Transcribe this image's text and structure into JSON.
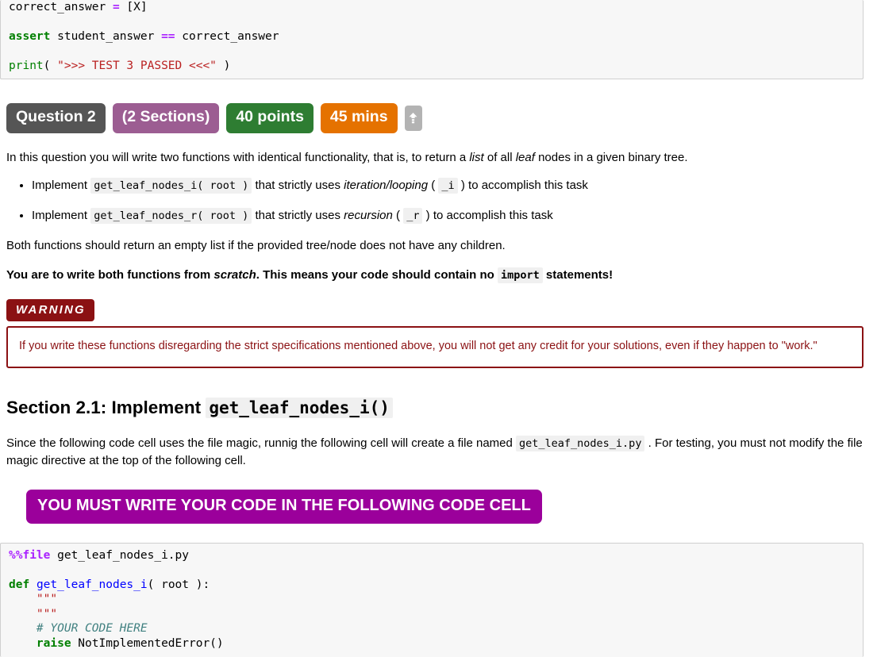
{
  "top_code_cell": {
    "name": "test-3-code-cell",
    "lines": [
      [
        {
          "t": "correct_answer ",
          "c": "plain"
        },
        {
          "t": "=",
          "c": "op"
        },
        {
          "t": " [X]",
          "c": "plain"
        }
      ],
      [],
      [
        {
          "t": "assert",
          "c": "kw"
        },
        {
          "t": " student_answer ",
          "c": "plain"
        },
        {
          "t": "==",
          "c": "op"
        },
        {
          "t": " correct_answer",
          "c": "plain"
        }
      ],
      [],
      [
        {
          "t": "print",
          "c": "bi"
        },
        {
          "t": "( ",
          "c": "plain"
        },
        {
          "t": "\">>> TEST 3 PASSED <<<\"",
          "c": "str"
        },
        {
          "t": " )",
          "c": "plain"
        }
      ]
    ]
  },
  "badges": {
    "question": "Question 2",
    "sections": "(2 Sections)",
    "points": "40 points",
    "time": "45 mins",
    "toggle_icon": "arrow-up-icon",
    "colors": {
      "question": "#555555",
      "sections": "#9c5d92",
      "points": "#2e7d32",
      "time": "#e57200",
      "toggle": "#b3b3b3"
    }
  },
  "intro": {
    "p1_a": "In this question you will write two functions with identical functionality, that is, to return a ",
    "p1_list": "list",
    "p1_b": " of all ",
    "p1_leaf": "leaf",
    "p1_c": " nodes in a given binary tree."
  },
  "bullets": [
    {
      "lead": "Implement ",
      "code": "get_leaf_nodes_i( root )",
      "mid": " that strictly uses ",
      "em": "iteration/looping",
      "paren_open": " ( ",
      "code2": "_i",
      "paren_close": " ) ",
      "tail": "to accomplish this task"
    },
    {
      "lead": "Implement ",
      "code": "get_leaf_nodes_r( root )",
      "mid": " that strictly uses ",
      "em": "recursion",
      "paren_open": " ( ",
      "code2": "_r",
      "paren_close": " ) ",
      "tail": "to accomplish this task"
    }
  ],
  "notes": {
    "empty_list": "Both functions should return an empty list if the provided tree/node does not have any children.",
    "scratch_a": "You are to write both functions from ",
    "scratch_em": "scratch",
    "scratch_b": ". This means your code should contain no ",
    "scratch_code": "import",
    "scratch_c": " statements!"
  },
  "warning": {
    "label": "WARNING",
    "text": "If you write these functions disregarding the strict specifications mentioned above, you will not get any credit for your solutions, even if they happen to \"work.\"",
    "color": "#8b1113"
  },
  "section": {
    "heading_text": "Section 2.1: Implement ",
    "heading_code": "get_leaf_nodes_i()",
    "para_a": "Since the following code cell uses the file magic, runnig the following cell will create a file named ",
    "para_code": "get_leaf_nodes_i.py",
    "para_b": " . For testing, you must not modify the file magic directive at the top of the following cell."
  },
  "must_banner": {
    "text": "YOU MUST WRITE YOUR CODE IN THE FOLLOWING CODE CELL",
    "color": "#9b009b"
  },
  "bottom_code_cell": {
    "name": "get-leaf-nodes-i-code-cell",
    "lines": [
      [
        {
          "t": "%%file",
          "c": "magic"
        },
        {
          "t": " get_leaf_nodes_i.py",
          "c": "plain"
        }
      ],
      [],
      [
        {
          "t": "def",
          "c": "kw"
        },
        {
          "t": " ",
          "c": "plain"
        },
        {
          "t": "get_leaf_nodes_i",
          "c": "fn"
        },
        {
          "t": "( root ):",
          "c": "plain"
        }
      ],
      [
        {
          "t": "    \"\"\"",
          "c": "str"
        }
      ],
      [
        {
          "t": "    \"\"\"",
          "c": "str"
        }
      ],
      [
        {
          "t": "    # YOUR CODE HERE",
          "c": "cm"
        }
      ],
      [
        {
          "t": "    ",
          "c": "plain"
        },
        {
          "t": "raise",
          "c": "kw"
        },
        {
          "t": " NotImplementedError()",
          "c": "plain"
        }
      ]
    ]
  }
}
